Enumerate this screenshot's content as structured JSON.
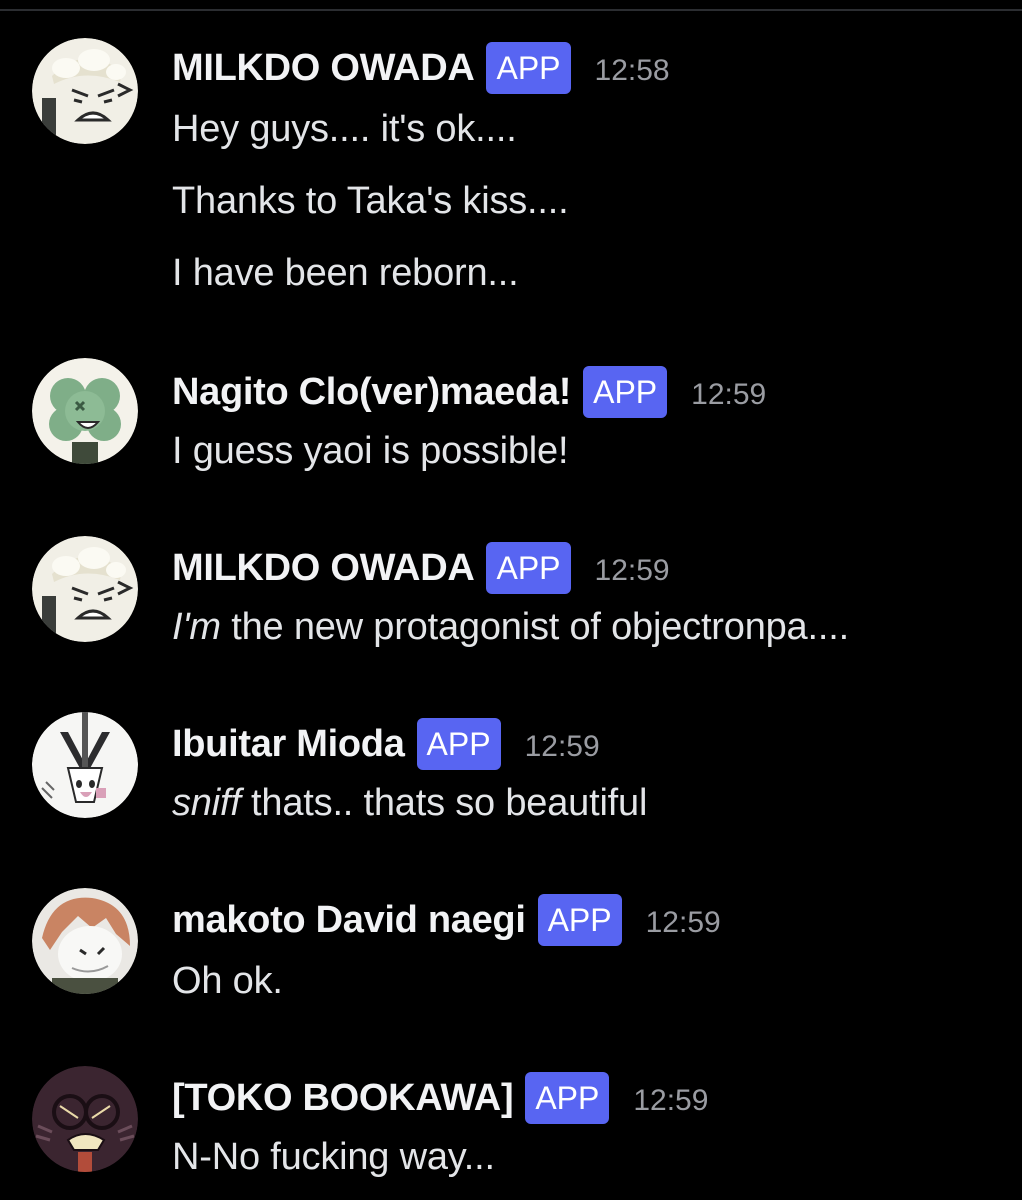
{
  "colors": {
    "background": "#000000",
    "app_tag": "#5865f2",
    "username": "#f2f3f5",
    "timestamp": "#9a9ca2",
    "message_text": "#e3e5e8"
  },
  "messages": [
    {
      "username": "MILKDO OWADA",
      "tag": "APP",
      "time": "12:58",
      "avatar": "milk-carton-avatar",
      "lines": [
        "Hey guys.... it's ok....",
        "Thanks to Taka's kiss....",
        "I have been reborn..."
      ]
    },
    {
      "username": "Nagito Clo(ver)maeda!",
      "tag": "APP",
      "time": "12:59",
      "avatar": "clover-avatar",
      "lines": [
        "I guess yaoi is possible!"
      ]
    },
    {
      "username": "MILKDO OWADA",
      "tag": "APP",
      "time": "12:59",
      "avatar": "milk-carton-avatar",
      "lines_styled": [
        {
          "italic": "I'm",
          "rest": " the new protagonist of objectronpa...."
        }
      ]
    },
    {
      "username": "Ibuitar Mioda",
      "tag": "APP",
      "time": "12:59",
      "avatar": "guitar-avatar",
      "lines_styled": [
        {
          "italic": "sniff",
          "rest": " thats.. thats so beautiful"
        }
      ]
    },
    {
      "username": "makoto David naegi",
      "tag": "APP",
      "time": "12:59",
      "avatar": "hair-character-avatar",
      "lines": [
        "Oh ok."
      ]
    },
    {
      "username": "[TOKO BOOKAWA]",
      "tag": "APP",
      "time": "12:59",
      "avatar": "book-glasses-avatar",
      "lines": [
        "N-No fucking way..."
      ]
    }
  ]
}
